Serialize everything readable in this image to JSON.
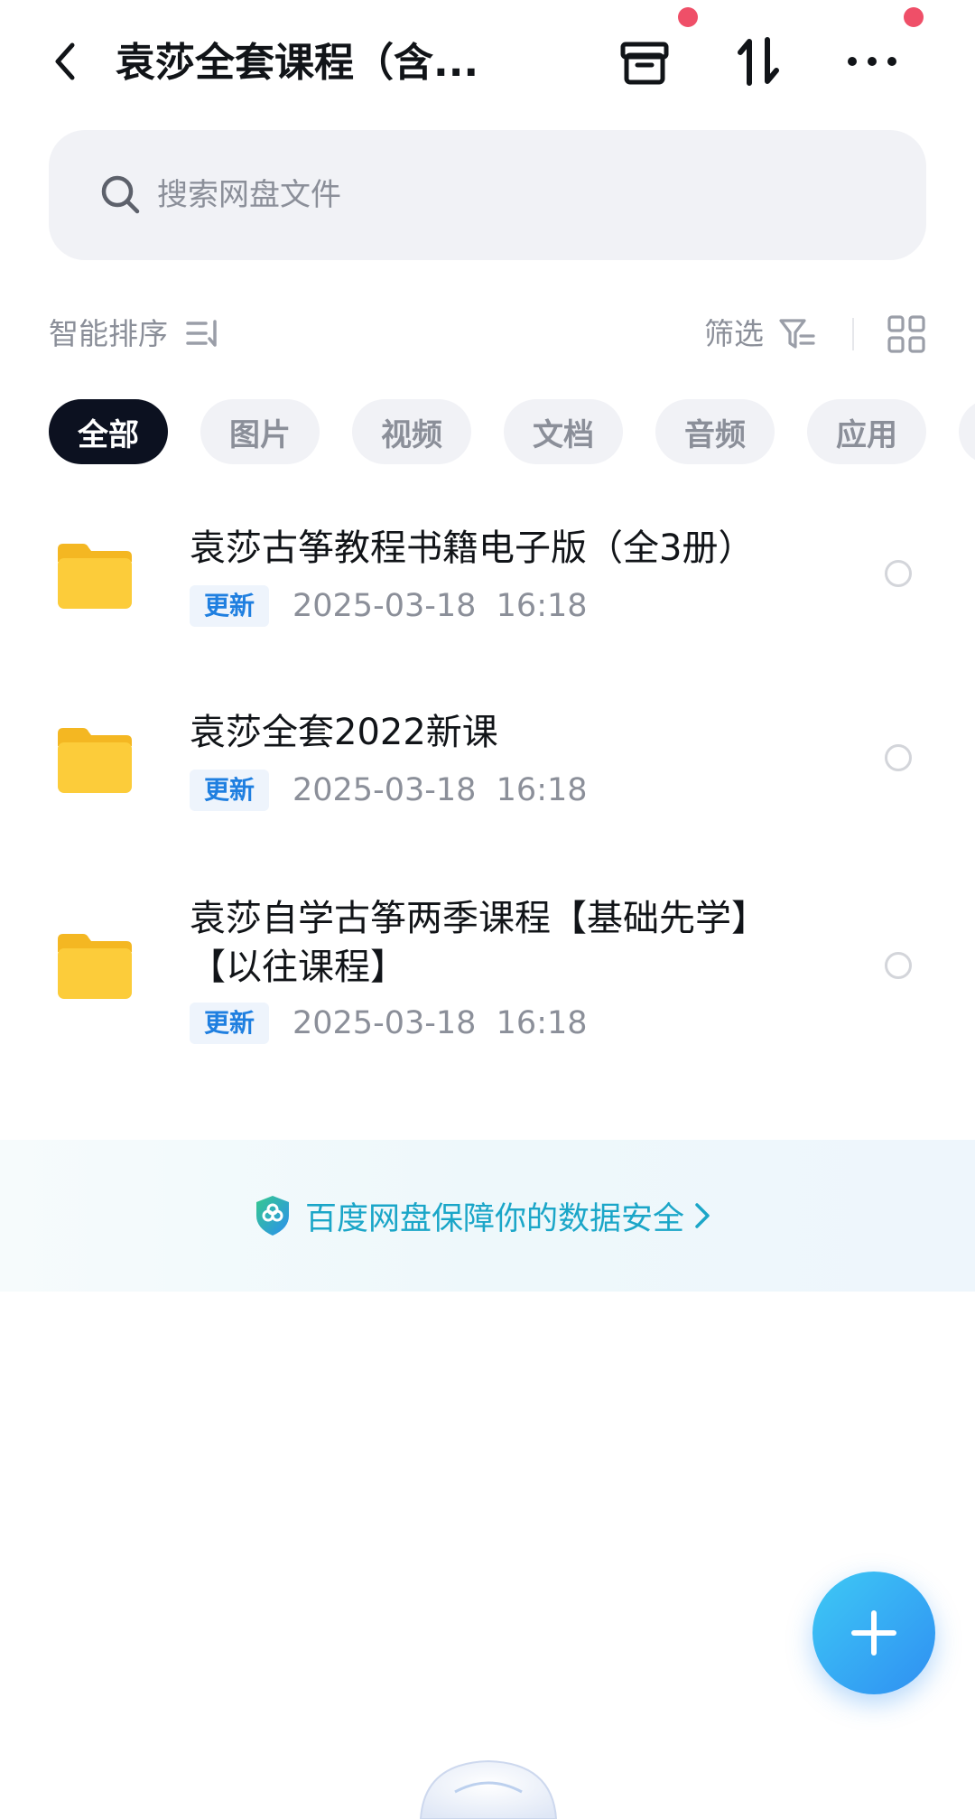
{
  "header": {
    "title": "袁莎全套课程（含...",
    "back_icon": "chevron-left-icon",
    "actions": [
      {
        "name": "archive",
        "icon": "archive-box-icon",
        "has_badge": true
      },
      {
        "name": "transfer",
        "icon": "transfer-arrows-icon",
        "has_badge": false
      },
      {
        "name": "more",
        "icon": "more-dots-icon",
        "has_badge": true
      }
    ],
    "badge_color": "#ef4f68"
  },
  "search": {
    "placeholder": "搜索网盘文件",
    "icon": "search-icon"
  },
  "toolbar": {
    "sort_label": "智能排序",
    "filter_label": "筛选",
    "view_icon": "grid-view-icon"
  },
  "tabs": [
    {
      "label": "全部",
      "active": true
    },
    {
      "label": "图片",
      "active": false
    },
    {
      "label": "视频",
      "active": false
    },
    {
      "label": "文档",
      "active": false
    },
    {
      "label": "音频",
      "active": false
    },
    {
      "label": "应用",
      "active": false
    }
  ],
  "files": [
    {
      "name": "袁莎古筝教程书籍电子版（全3册）",
      "badge": "更新",
      "date": "2025-03-18  16:18",
      "type": "folder"
    },
    {
      "name": "袁莎全套2022新课",
      "badge": "更新",
      "date": "2025-03-18  16:18",
      "type": "folder"
    },
    {
      "name": "袁莎自学古筝两季课程【基础先学】【以往课程】",
      "badge": "更新",
      "date": "2025-03-18  16:18",
      "type": "folder"
    }
  ],
  "security_banner": {
    "text": "百度网盘保障你的数据安全",
    "icon": "shield-icon"
  },
  "fab": {
    "icon": "plus-icon"
  },
  "colors": {
    "active_tab_bg": "#0c1120",
    "badge_text": "#1f7fe0",
    "banner_text": "#1ba6c8",
    "folder": "#fccc3a",
    "fab_gradient": [
      "#3ec9f5",
      "#2f8ff2"
    ]
  }
}
